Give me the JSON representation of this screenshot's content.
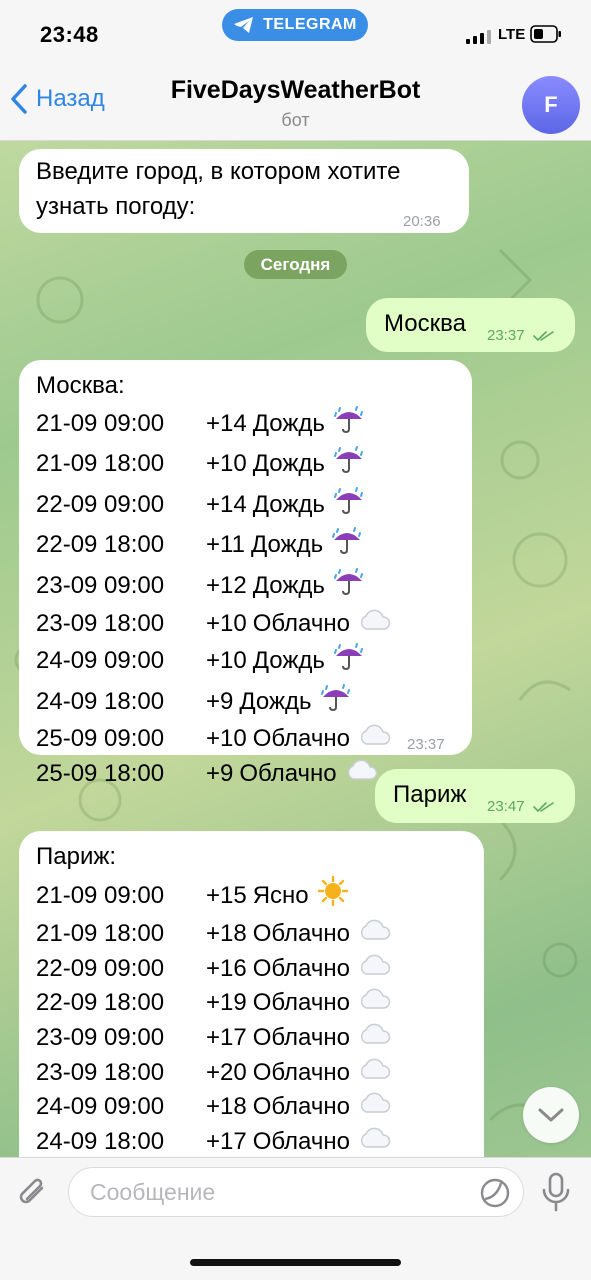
{
  "status_bar": {
    "time": "23:48",
    "app_pill": "TELEGRAM",
    "network": "LTE"
  },
  "header": {
    "back_label": "Назад",
    "title": "FiveDaysWeatherBot",
    "subtitle": "бот",
    "avatar_letter": "F"
  },
  "date_separator": "Сегодня",
  "messages": {
    "bot_prompt": {
      "text_line1": "Введите город, в котором хотите",
      "text_line2": "узнать погоду:",
      "time": "20:36"
    },
    "user_moscow": {
      "text": "Москва",
      "time": "23:37"
    },
    "moscow_forecast": {
      "city": "Москва:",
      "time": "23:37",
      "rows": [
        {
          "date": "21-09 09:00",
          "temp": "+14",
          "cond": "Дождь",
          "icon": "umbrella-rain-icon"
        },
        {
          "date": "21-09 18:00",
          "temp": "+10",
          "cond": "Дождь",
          "icon": "umbrella-rain-icon"
        },
        {
          "date": "22-09 09:00",
          "temp": "+14",
          "cond": "Дождь",
          "icon": "umbrella-rain-icon"
        },
        {
          "date": "22-09 18:00",
          "temp": "+11",
          "cond": "Дождь",
          "icon": "umbrella-rain-icon"
        },
        {
          "date": "23-09 09:00",
          "temp": "+12",
          "cond": "Дождь",
          "icon": "umbrella-rain-icon"
        },
        {
          "date": "23-09 18:00",
          "temp": "+10",
          "cond": "Облачно",
          "icon": "cloud-icon"
        },
        {
          "date": "24-09 09:00",
          "temp": "+10",
          "cond": "Дождь",
          "icon": "umbrella-rain-icon"
        },
        {
          "date": "24-09 18:00",
          "temp": "+9",
          "cond": "Дождь",
          "icon": "umbrella-rain-icon"
        },
        {
          "date": "25-09 09:00",
          "temp": "+10",
          "cond": "Облачно",
          "icon": "cloud-icon"
        },
        {
          "date": "25-09 18:00",
          "temp": "+9",
          "cond": "Облачно",
          "icon": "cloud-icon"
        }
      ]
    },
    "user_paris": {
      "text": "Париж",
      "time": "23:47"
    },
    "paris_forecast": {
      "city": "Париж:",
      "rows": [
        {
          "date": "21-09 09:00",
          "temp": "+15",
          "cond": "Ясно",
          "icon": "sun-icon"
        },
        {
          "date": "21-09 18:00",
          "temp": "+18",
          "cond": "Облачно",
          "icon": "cloud-icon"
        },
        {
          "date": "22-09 09:00",
          "temp": "+16",
          "cond": "Облачно",
          "icon": "cloud-icon"
        },
        {
          "date": "22-09 18:00",
          "temp": "+19",
          "cond": "Облачно",
          "icon": "cloud-icon"
        },
        {
          "date": "23-09 09:00",
          "temp": "+17",
          "cond": "Облачно",
          "icon": "cloud-icon"
        },
        {
          "date": "23-09 18:00",
          "temp": "+20",
          "cond": "Облачно",
          "icon": "cloud-icon"
        },
        {
          "date": "24-09 09:00",
          "temp": "+18",
          "cond": "Облачно",
          "icon": "cloud-icon"
        },
        {
          "date": "24-09 18:00",
          "temp": "+17",
          "cond": "Облачно",
          "icon": "cloud-icon"
        }
      ]
    }
  },
  "input": {
    "placeholder": "Сообщение"
  },
  "colors": {
    "accent": "#2f86e4",
    "outgoing_bubble": "#e1fec6",
    "incoming_bubble": "#ffffff",
    "read_check": "#5fa864"
  }
}
